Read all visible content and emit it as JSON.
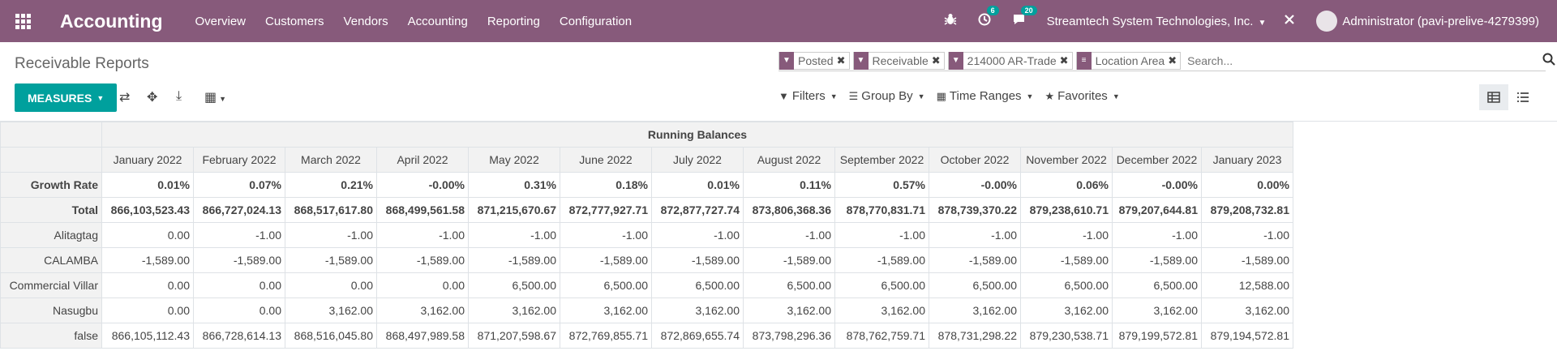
{
  "navbar": {
    "brand": "Accounting",
    "menu": [
      "Overview",
      "Customers",
      "Vendors",
      "Accounting",
      "Reporting",
      "Configuration"
    ],
    "activity_count": "6",
    "messages_count": "20",
    "company": "Streamtech System Technologies, Inc.",
    "user": "Administrator (pavi-prelive-4279399)"
  },
  "control_panel": {
    "breadcrumb": "Receivable Reports",
    "facets": [
      "Posted",
      "Receivable",
      "214000 AR-Trade",
      "Location Area"
    ],
    "search_placeholder": "Search...",
    "measures_label": "MEASURES",
    "filters_label": "Filters",
    "group_by_label": "Group By",
    "time_ranges_label": "Time Ranges",
    "favorites_label": "Favorites"
  },
  "pivot": {
    "column_group": "Running Balances",
    "months": [
      "January 2022",
      "February 2022",
      "March 2022",
      "April 2022",
      "May 2022",
      "June 2022",
      "July 2022",
      "August 2022",
      "September 2022",
      "October 2022",
      "November 2022",
      "December 2022",
      "January 2023"
    ],
    "rows": [
      {
        "label": "Growth Rate",
        "bold": true,
        "values": [
          "0.01%",
          "0.07%",
          "0.21%",
          "-0.00%",
          "0.31%",
          "0.18%",
          "0.01%",
          "0.11%",
          "0.57%",
          "-0.00%",
          "0.06%",
          "-0.00%",
          "0.00%"
        ]
      },
      {
        "label": "Total",
        "bold": true,
        "values": [
          "866,103,523.43",
          "866,727,024.13",
          "868,517,617.80",
          "868,499,561.58",
          "871,215,670.67",
          "872,777,927.71",
          "872,877,727.74",
          "873,806,368.36",
          "878,770,831.71",
          "878,739,370.22",
          "879,238,610.71",
          "879,207,644.81",
          "879,208,732.81"
        ]
      },
      {
        "label": "Alitagtag",
        "bold": false,
        "values": [
          "0.00",
          "-1.00",
          "-1.00",
          "-1.00",
          "-1.00",
          "-1.00",
          "-1.00",
          "-1.00",
          "-1.00",
          "-1.00",
          "-1.00",
          "-1.00",
          "-1.00"
        ]
      },
      {
        "label": "CALAMBA",
        "bold": false,
        "values": [
          "-1,589.00",
          "-1,589.00",
          "-1,589.00",
          "-1,589.00",
          "-1,589.00",
          "-1,589.00",
          "-1,589.00",
          "-1,589.00",
          "-1,589.00",
          "-1,589.00",
          "-1,589.00",
          "-1,589.00",
          "-1,589.00"
        ]
      },
      {
        "label": "Commercial Villar",
        "bold": false,
        "values": [
          "0.00",
          "0.00",
          "0.00",
          "0.00",
          "6,500.00",
          "6,500.00",
          "6,500.00",
          "6,500.00",
          "6,500.00",
          "6,500.00",
          "6,500.00",
          "6,500.00",
          "12,588.00"
        ]
      },
      {
        "label": "Nasugbu",
        "bold": false,
        "values": [
          "0.00",
          "0.00",
          "3,162.00",
          "3,162.00",
          "3,162.00",
          "3,162.00",
          "3,162.00",
          "3,162.00",
          "3,162.00",
          "3,162.00",
          "3,162.00",
          "3,162.00",
          "3,162.00"
        ]
      },
      {
        "label": "false",
        "bold": false,
        "values": [
          "866,105,112.43",
          "866,728,614.13",
          "868,516,045.80",
          "868,497,989.58",
          "871,207,598.67",
          "872,769,855.71",
          "872,869,655.74",
          "873,798,296.36",
          "878,762,759.71",
          "878,731,298.22",
          "879,230,538.71",
          "879,199,572.81",
          "879,194,572.81"
        ]
      }
    ]
  }
}
